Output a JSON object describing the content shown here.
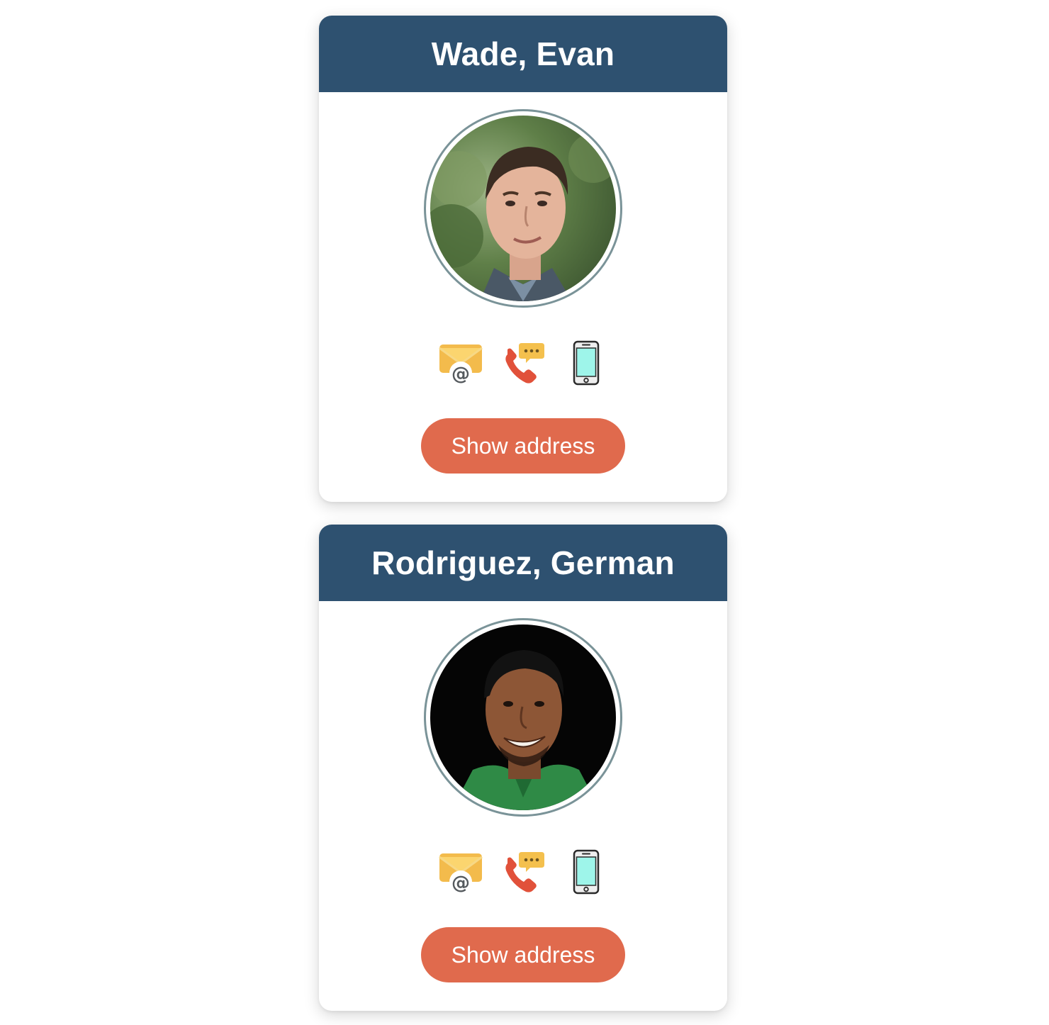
{
  "contacts": [
    {
      "name": "Wade, Evan",
      "button_label": "Show address",
      "icons": [
        "email-icon",
        "phone-call-icon",
        "mobile-phone-icon"
      ]
    },
    {
      "name": "Rodriguez, German",
      "button_label": "Show address",
      "icons": [
        "email-icon",
        "phone-call-icon",
        "mobile-phone-icon"
      ]
    }
  ],
  "colors": {
    "header": "#2e5170",
    "button": "#e06a4d",
    "avatar_ring": "#7a9398"
  }
}
